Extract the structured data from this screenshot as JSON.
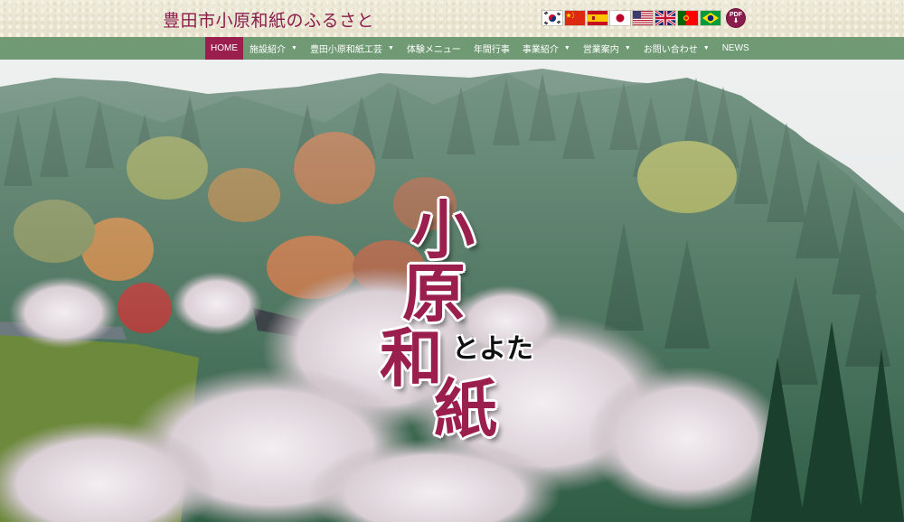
{
  "header": {
    "site_title": "豊田市小原和紙のふるさと",
    "flags": [
      "korea-flag-icon",
      "china-flag-icon",
      "spain-flag-icon",
      "japan-flag-icon",
      "usa-flag-icon",
      "uk-flag-icon",
      "portugal-flag-icon",
      "brazil-flag-icon"
    ],
    "pdf_label": "PDF"
  },
  "nav": {
    "items": [
      {
        "label": "HOME",
        "active": true,
        "dropdown": false
      },
      {
        "label": "施設紹介",
        "dropdown": true
      },
      {
        "label": "豊田小原和紙工芸",
        "dropdown": true
      },
      {
        "label": "体験メニュー",
        "dropdown": false
      },
      {
        "label": "年間行事",
        "dropdown": false
      },
      {
        "label": "事業紹介",
        "dropdown": true
      },
      {
        "label": "営業案内",
        "dropdown": true
      },
      {
        "label": "お問い合わせ",
        "dropdown": true
      },
      {
        "label": "NEWS",
        "dropdown": false
      }
    ],
    "caret": "▼"
  },
  "hero": {
    "title_chars": [
      "小",
      "原",
      "和",
      "紙"
    ],
    "subtitle": "とよた"
  },
  "colors": {
    "accent": "#9b1f4d",
    "nav_bg": "#6f9a73",
    "header_bg": "#ece8d6"
  }
}
